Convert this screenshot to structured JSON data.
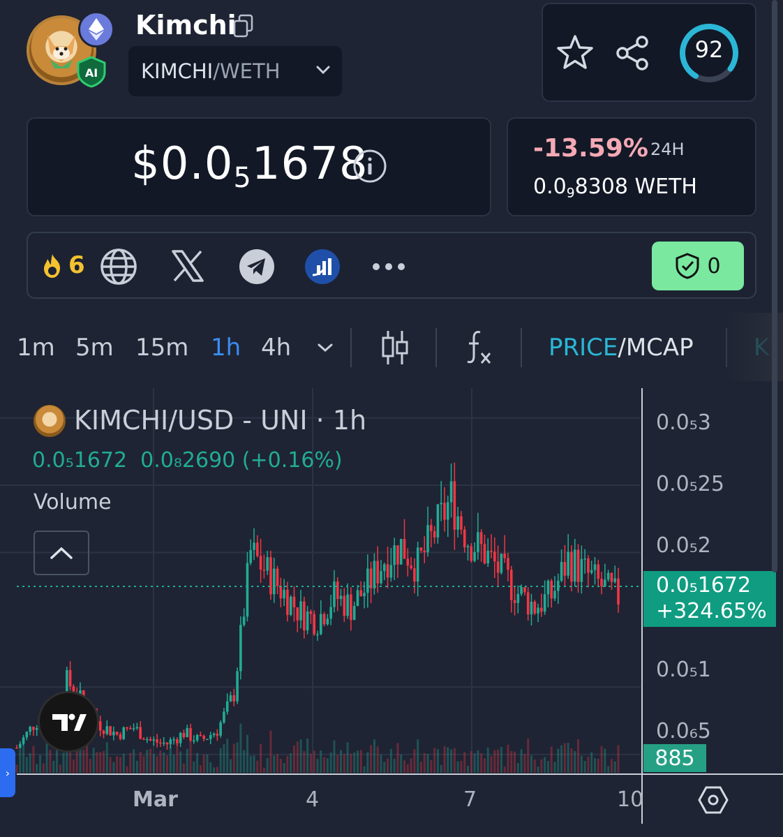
{
  "header": {
    "token_name": "Kimchi",
    "pair_base": "KIMCHI",
    "pair_quote": "WETH",
    "pair_separator": " / ",
    "ai_badge": "AI",
    "score": "92",
    "score_fraction": 0.92
  },
  "price": {
    "usd_prefix": "$0.0",
    "usd_zeros": "5",
    "usd_digits": "1678",
    "change_pct": "-13.59%",
    "change_period": "24H",
    "weth_prefix": "0.0",
    "weth_zeros": "9",
    "weth_digits": "8308",
    "weth_unit": " WETH"
  },
  "socials": {
    "flame_count": "6",
    "audit_count": "0"
  },
  "toolbar": {
    "timeframes": [
      "1m",
      "5m",
      "15m",
      "1h",
      "4h"
    ],
    "active_timeframe": "1h",
    "price_label": "PRICE",
    "mcap_label": "/MCAP",
    "cut_label": "K"
  },
  "colors": {
    "up": "#22ab94",
    "down": "#f23645",
    "accent_blue": "#3b8cf0",
    "cyan": "#2bb6d6",
    "audit_green": "#7be8a0",
    "change_negative": "#f4a9b4"
  },
  "chart": {
    "symbol": "KIMCHI/USD - UNI · 1h",
    "legend_close": "0.0₅1672",
    "legend_change": "0.0₈2690 (+0.16%)",
    "volume_label": "Volume",
    "last_price": "0.0₅1672",
    "last_change": "+324.65%",
    "volume_value": "885",
    "y_labels": [
      "0.0₅3",
      "0.0₅25",
      "0.0₅2",
      "0.0₅1672",
      "0.0₅1",
      "0.0₆5"
    ],
    "x_labels": [
      "Mar",
      "4",
      "7",
      "10"
    ]
  },
  "chart_data": {
    "type": "candlestick",
    "interval": "1h",
    "ylim": [
      4e-06,
      3.2e-05
    ],
    "y_ticks": [
      5e-06,
      1e-05,
      2e-05,
      2.5e-05,
      3e-05
    ],
    "last_close": 1.672e-05,
    "series": [
      {
        "name": "KIMCHI/USD - UNI",
        "x_index": [
          0,
          5,
          10,
          15,
          20,
          25,
          30,
          35,
          40,
          45,
          50,
          55,
          60,
          65,
          70,
          75,
          80,
          85,
          90,
          95,
          100,
          105,
          110,
          115,
          120,
          125,
          130,
          135,
          140,
          145,
          150,
          155,
          160,
          165,
          170,
          175,
          180
        ],
        "close": [
          5.5e-06,
          7.2e-06,
          8.2e-06,
          1.05e-05,
          8.8e-06,
          7.2e-06,
          6.5e-06,
          7e-06,
          6e-06,
          5.8e-06,
          6.6e-06,
          6e-06,
          6.8e-06,
          9.5e-06,
          2e-05,
          1.85e-05,
          1.7e-05,
          1.55e-05,
          1.5e-05,
          1.68e-05,
          1.6e-05,
          1.75e-05,
          1.95e-05,
          2.05e-05,
          1.9e-05,
          2.15e-05,
          2.4e-05,
          2.1e-05,
          2e-05,
          1.85e-05,
          1.7e-05,
          1.6e-05,
          1.68e-05,
          1.95e-05,
          1.85e-05,
          1.75e-05,
          1.67e-05
        ]
      }
    ]
  }
}
